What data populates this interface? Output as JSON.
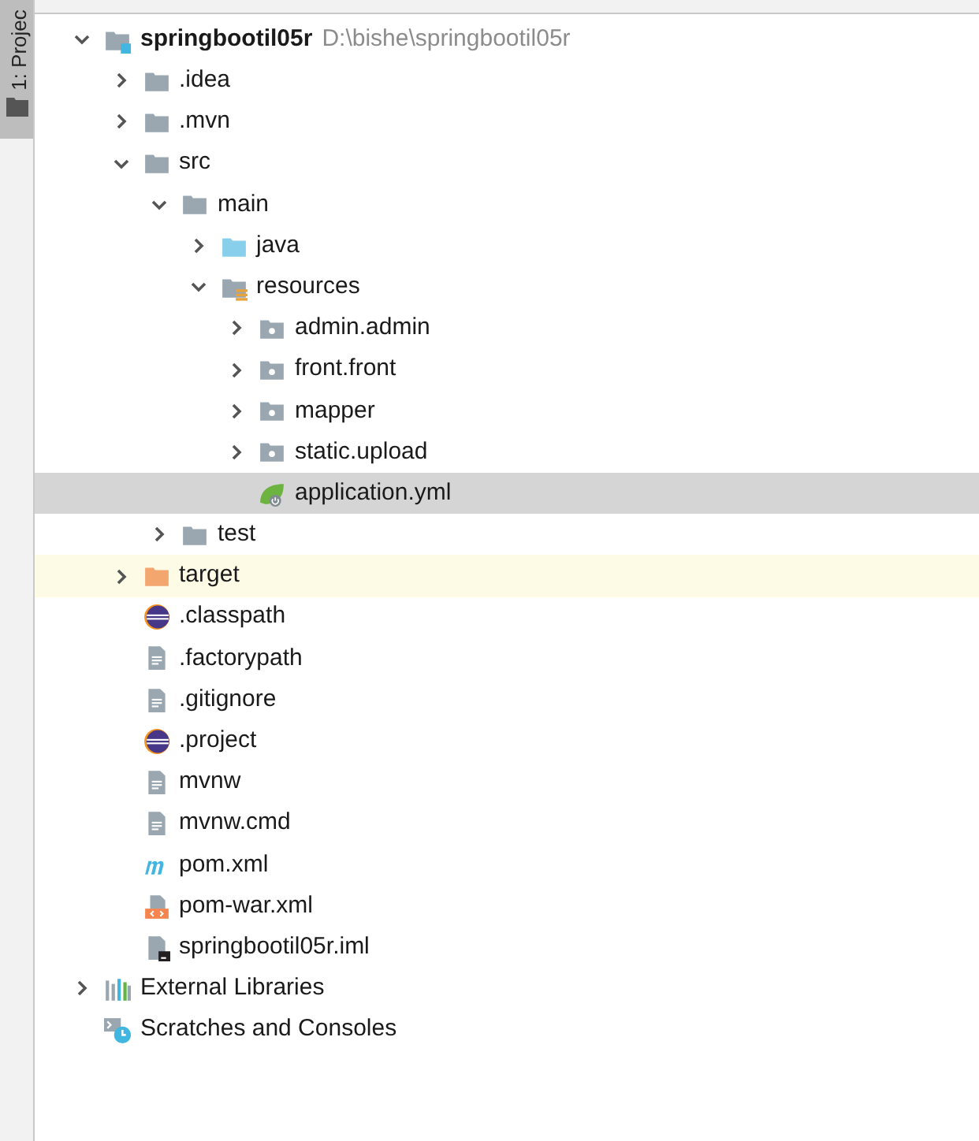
{
  "side_tab": {
    "label": "1: Projec",
    "selected": true
  },
  "tree": [
    {
      "name": "springbootil05r",
      "path": "D:\\bishe\\springbootil05r",
      "kind": "module",
      "expanded": true,
      "selected": false,
      "highlighted": false,
      "children": [
        {
          "name": ".idea",
          "kind": "folder",
          "expanded": false,
          "selected": false,
          "highlighted": false
        },
        {
          "name": ".mvn",
          "kind": "folder",
          "expanded": false,
          "selected": false,
          "highlighted": false
        },
        {
          "name": "src",
          "kind": "folder",
          "expanded": true,
          "selected": false,
          "highlighted": false,
          "children": [
            {
              "name": "main",
              "kind": "folder",
              "expanded": true,
              "selected": false,
              "highlighted": false,
              "children": [
                {
                  "name": "java",
                  "kind": "source",
                  "expanded": false,
                  "selected": false,
                  "highlighted": false
                },
                {
                  "name": "resources",
                  "kind": "resources",
                  "expanded": true,
                  "selected": false,
                  "highlighted": false,
                  "children": [
                    {
                      "name": "admin.admin",
                      "kind": "package",
                      "expanded": false,
                      "selected": false,
                      "highlighted": false
                    },
                    {
                      "name": "front.front",
                      "kind": "package",
                      "expanded": false,
                      "selected": false,
                      "highlighted": false
                    },
                    {
                      "name": "mapper",
                      "kind": "package",
                      "expanded": false,
                      "selected": false,
                      "highlighted": false
                    },
                    {
                      "name": "static.upload",
                      "kind": "package",
                      "expanded": false,
                      "selected": false,
                      "highlighted": false
                    },
                    {
                      "name": "application.yml",
                      "kind": "spring",
                      "selected": true,
                      "highlighted": false
                    }
                  ]
                }
              ]
            },
            {
              "name": "test",
              "kind": "folder",
              "expanded": false,
              "selected": false,
              "highlighted": false
            }
          ]
        },
        {
          "name": "target",
          "kind": "excluded",
          "expanded": false,
          "selected": false,
          "highlighted": true
        },
        {
          "name": ".classpath",
          "kind": "eclipse",
          "selected": false,
          "highlighted": false
        },
        {
          "name": ".factorypath",
          "kind": "text",
          "selected": false,
          "highlighted": false
        },
        {
          "name": ".gitignore",
          "kind": "text",
          "selected": false,
          "highlighted": false
        },
        {
          "name": ".project",
          "kind": "eclipse",
          "selected": false,
          "highlighted": false
        },
        {
          "name": "mvnw",
          "kind": "text",
          "selected": false,
          "highlighted": false
        },
        {
          "name": "mvnw.cmd",
          "kind": "text",
          "selected": false,
          "highlighted": false
        },
        {
          "name": "pom.xml",
          "kind": "maven",
          "selected": false,
          "highlighted": false
        },
        {
          "name": "pom-war.xml",
          "kind": "xml",
          "selected": false,
          "highlighted": false
        },
        {
          "name": "springbootil05r.iml",
          "kind": "iml",
          "selected": false,
          "highlighted": false
        }
      ]
    },
    {
      "name": "External Libraries",
      "kind": "libraries",
      "expanded": false,
      "selected": false,
      "highlighted": false
    },
    {
      "name": "Scratches and Consoles",
      "kind": "scratches",
      "selected": false,
      "highlighted": false
    }
  ]
}
